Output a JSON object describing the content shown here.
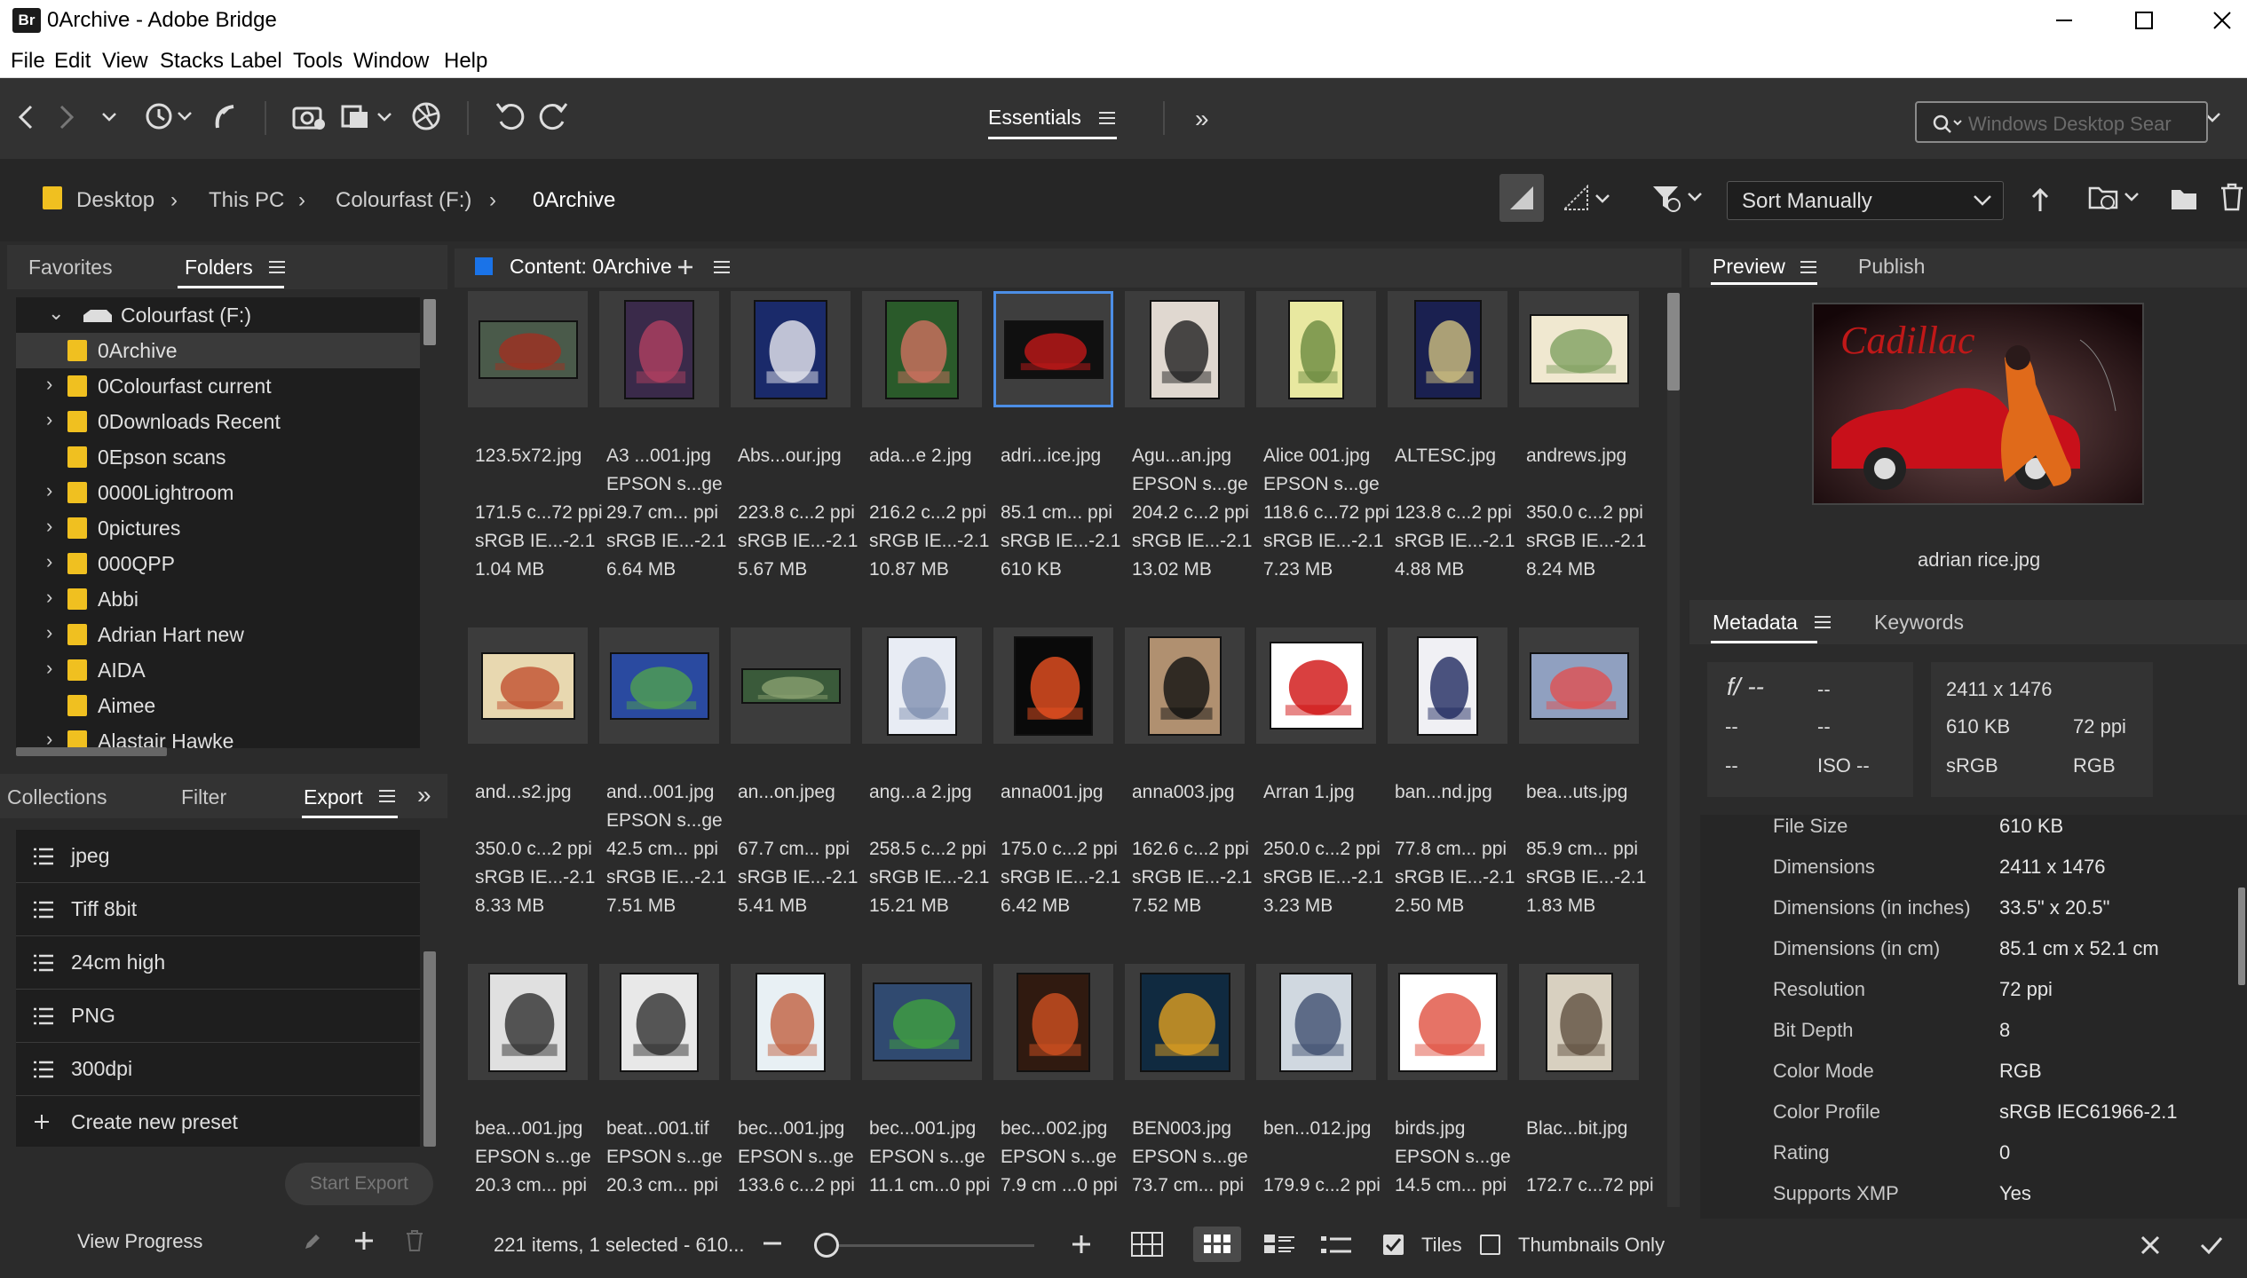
{
  "window": {
    "title": "0Archive - Adobe Bridge",
    "logo": "Br"
  },
  "menu": [
    "File",
    "Edit",
    "View",
    "Stacks",
    "Label",
    "Tools",
    "Window",
    "Help"
  ],
  "toolbar": {
    "workspace": "Essentials",
    "search_placeholder": "Windows Desktop Sear"
  },
  "path": [
    "Desktop",
    "This PC",
    "Colourfast  (F:)",
    "0Archive"
  ],
  "sort": {
    "label": "Sort Manually"
  },
  "left_panel": {
    "tabs": [
      "Favorites",
      "Folders"
    ],
    "tree_root": "Colourfast  (F:)",
    "folders": [
      "0Archive",
      "0Colourfast current",
      "0Downloads Recent",
      "0Epson scans",
      "0000Lightroom",
      "0pictures",
      "000QPP",
      "Abbi",
      "Adrian Hart new",
      "AIDA",
      "Aimee",
      "Alastair Hawke"
    ],
    "bottom_tabs": [
      "Collections",
      "Filter",
      "Export"
    ],
    "presets": [
      "jpeg",
      "Tiff 8bit",
      "24cm high",
      "PNG",
      "300dpi"
    ],
    "create_preset": "Create new preset",
    "start_export": "Start Export",
    "view_progress": "View Progress"
  },
  "content": {
    "title": "Content: 0Archive",
    "items": [
      {
        "name": "123.5x72.jpg",
        "l2": "",
        "l3": "171.5 c...72 ppi",
        "l4": "sRGB IE...-2.1",
        "l5": "1.04 MB"
      },
      {
        "name": "A3 ...001.jpg",
        "l2": "EPSON s...ge",
        "l3": "29.7 cm... ppi",
        "l4": "sRGB IE...-2.1",
        "l5": "6.64 MB"
      },
      {
        "name": "Abs...our.jpg",
        "l2": "",
        "l3": "223.8 c...2 ppi",
        "l4": "sRGB IE...-2.1",
        "l5": "5.67 MB"
      },
      {
        "name": "ada...e 2.jpg",
        "l2": "",
        "l3": "216.2 c...2 ppi",
        "l4": "sRGB IE...-2.1",
        "l5": "10.87 MB"
      },
      {
        "name": "adri...ice.jpg",
        "l2": "",
        "l3": "85.1 cm... ppi",
        "l4": "sRGB IE...-2.1",
        "l5": "610 KB"
      },
      {
        "name": "Agu...an.jpg",
        "l2": "EPSON s...ge",
        "l3": "204.2 c...2 ppi",
        "l4": "sRGB IE...-2.1",
        "l5": "13.02 MB"
      },
      {
        "name": "Alice 001.jpg",
        "l2": "EPSON s...ge",
        "l3": "118.6 c...72 ppi",
        "l4": "sRGB IE...-2.1",
        "l5": "7.23 MB"
      },
      {
        "name": "ALTESC.jpg",
        "l2": "",
        "l3": "123.8 c...2 ppi",
        "l4": "sRGB IE...-2.1",
        "l5": "4.88 MB"
      },
      {
        "name": "andrews.jpg",
        "l2": "",
        "l3": "350.0 c...2 ppi",
        "l4": "sRGB IE...-2.1",
        "l5": "8.24 MB"
      },
      {
        "name": "and...s2.jpg",
        "l2": "",
        "l3": "350.0 c...2 ppi",
        "l4": "sRGB IE...-2.1",
        "l5": "8.33 MB"
      },
      {
        "name": "and...001.jpg",
        "l2": "EPSON s...ge",
        "l3": "42.5 cm... ppi",
        "l4": "sRGB IE...-2.1",
        "l5": "7.51 MB"
      },
      {
        "name": "an...on.jpeg",
        "l2": "",
        "l3": "67.7 cm... ppi",
        "l4": "sRGB IE...-2.1",
        "l5": "5.41 MB"
      },
      {
        "name": "ang...a 2.jpg",
        "l2": "",
        "l3": "258.5 c...2 ppi",
        "l4": "sRGB IE...-2.1",
        "l5": "15.21 MB"
      },
      {
        "name": "anna001.jpg",
        "l2": "",
        "l3": "175.0 c...2 ppi",
        "l4": "sRGB IE...-2.1",
        "l5": "6.42 MB"
      },
      {
        "name": "anna003.jpg",
        "l2": "",
        "l3": "162.6 c...2 ppi",
        "l4": "sRGB IE...-2.1",
        "l5": "7.52 MB"
      },
      {
        "name": "Arran 1.jpg",
        "l2": "",
        "l3": "250.0 c...2 ppi",
        "l4": "sRGB IE...-2.1",
        "l5": "3.23 MB"
      },
      {
        "name": "ban...nd.jpg",
        "l2": "",
        "l3": "77.8 cm... ppi",
        "l4": "sRGB IE...-2.1",
        "l5": "2.50 MB"
      },
      {
        "name": "bea...uts.jpg",
        "l2": "",
        "l3": "85.9 cm... ppi",
        "l4": "sRGB IE...-2.1",
        "l5": "1.83 MB"
      },
      {
        "name": "bea...001.jpg",
        "l2": "EPSON s...ge",
        "l3": "20.3 cm... ppi",
        "l4": "",
        "l5": ""
      },
      {
        "name": "beat...001.tif",
        "l2": "EPSON s...ge",
        "l3": "20.3 cm... ppi",
        "l4": "",
        "l5": ""
      },
      {
        "name": "bec...001.jpg",
        "l2": "EPSON s...ge",
        "l3": "133.6 c...2 ppi",
        "l4": "",
        "l5": ""
      },
      {
        "name": "bec...001.jpg",
        "l2": "EPSON s...ge",
        "l3": "11.1 cm...0 ppi",
        "l4": "",
        "l5": ""
      },
      {
        "name": "bec...002.jpg",
        "l2": "EPSON s...ge",
        "l3": "7.9 cm ...0 ppi",
        "l4": "",
        "l5": ""
      },
      {
        "name": "BEN003.jpg",
        "l2": "EPSON s...ge",
        "l3": "73.7 cm... ppi",
        "l4": "",
        "l5": ""
      },
      {
        "name": "ben...012.jpg",
        "l2": "",
        "l3": "179.9 c...2 ppi",
        "l4": "",
        "l5": ""
      },
      {
        "name": "birds.jpg",
        "l2": "EPSON s...ge",
        "l3": "14.5 cm... ppi",
        "l4": "",
        "l5": ""
      },
      {
        "name": "Blac...bit.jpg",
        "l2": "",
        "l3": "172.7 c...72 ppi",
        "l4": "",
        "l5": ""
      }
    ],
    "status": "221 items, 1 selected - 610...",
    "tiles_label": "Tiles",
    "thumbs_only_label": "Thumbnails Only"
  },
  "preview": {
    "tabs": [
      "Preview",
      "Publish"
    ],
    "filename": "adrian rice.jpg",
    "brand_text": "Cadillac"
  },
  "metadata": {
    "tabs": [
      "Metadata",
      "Keywords"
    ],
    "camera": {
      "aperture": "f/ --",
      "shutter": "--",
      "r2a": "--",
      "r2b": "--",
      "r3a": "--",
      "iso": "ISO --"
    },
    "summary": {
      "dims": "2411 x 1476",
      "size": "610 KB",
      "ppi": "72 ppi",
      "space": "sRGB",
      "mode": "RGB"
    },
    "rows": [
      {
        "k": "File Size",
        "v": "610 KB"
      },
      {
        "k": "Dimensions",
        "v": "2411 x 1476"
      },
      {
        "k": "Dimensions (in inches)",
        "v": "33.5\" x 20.5\""
      },
      {
        "k": "Dimensions (in cm)",
        "v": "85.1 cm x 52.1 cm"
      },
      {
        "k": "Resolution",
        "v": "72 ppi"
      },
      {
        "k": "Bit Depth",
        "v": "8"
      },
      {
        "k": "Color Mode",
        "v": "RGB"
      },
      {
        "k": "Color Profile",
        "v": "sRGB IEC61966-2.1"
      },
      {
        "k": "Rating",
        "v": "0"
      },
      {
        "k": "Supports XMP",
        "v": "Yes"
      }
    ]
  },
  "colors": {
    "accent": "#4c8ee6",
    "folder": "#f0c020"
  }
}
